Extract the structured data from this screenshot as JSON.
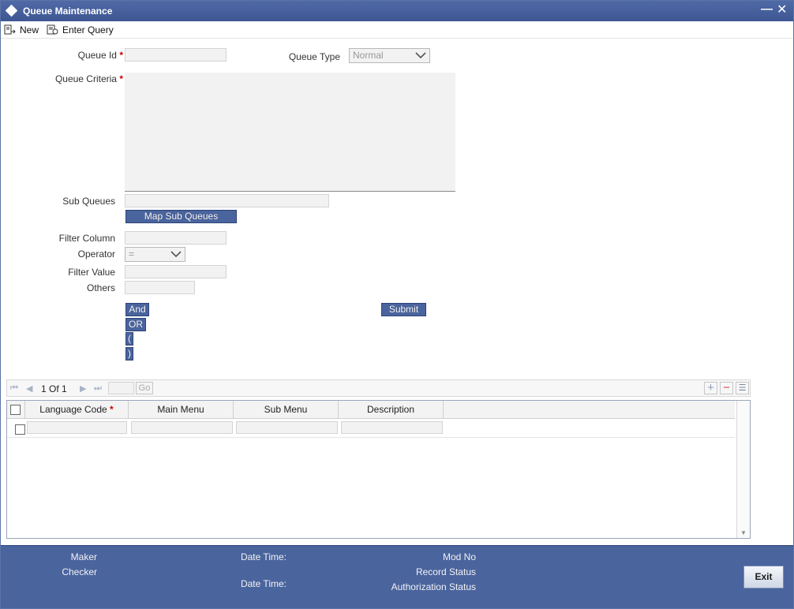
{
  "window": {
    "title": "Queue Maintenance"
  },
  "toolbar": {
    "new_label": "New",
    "enter_query_label": "Enter Query"
  },
  "form": {
    "queue_id_label": "Queue Id",
    "queue_id_value": "",
    "queue_type_label": "Queue Type",
    "queue_type_value": "Normal",
    "queue_criteria_label": "Queue Criteria",
    "required_mark": "*",
    "sub_queues_label": "Sub Queues",
    "map_sub_queues_label": "Map Sub Queues",
    "filter_column_label": "Filter Column",
    "operator_label": "Operator",
    "operator_value": "=",
    "filter_value_label": "Filter Value",
    "others_label": "Others",
    "and_label": "And",
    "or_label": "OR",
    "open_paren_label": "(",
    "close_paren_label": ")",
    "submit_label": "Submit"
  },
  "grid": {
    "page_current": "1",
    "page_of": "Of",
    "page_total": "1",
    "go_label": "Go",
    "columns": [
      "Language Code",
      "Main Menu",
      "Sub Menu",
      "Description"
    ]
  },
  "footer": {
    "maker_label": "Maker",
    "checker_label": "Checker",
    "date_time_label_1": "Date Time:",
    "date_time_label_2": "Date Time:",
    "mod_no_label": "Mod No",
    "record_status_label": "Record Status",
    "authorization_status_label": "Authorization Status",
    "exit_label": "Exit"
  }
}
